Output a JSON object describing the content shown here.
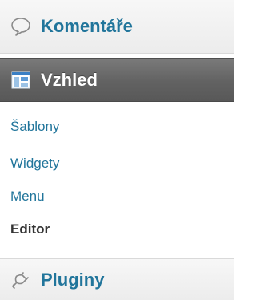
{
  "menu": {
    "comments": {
      "label": "Komentáře",
      "icon": "speech-bubble-icon"
    },
    "appearance": {
      "label": "Vzhled",
      "icon": "appearance-window-icon",
      "active": true
    },
    "appearance_submenu": [
      {
        "label": "Šablony"
      },
      {
        "label": "Widgety"
      },
      {
        "label": "Menu"
      },
      {
        "label": "Editor",
        "current": true
      }
    ],
    "plugins": {
      "label": "Pluginy",
      "icon": "plug-icon"
    }
  },
  "colors": {
    "link": "#21759b",
    "active_header_bg": "#636363",
    "current_text": "#333333"
  }
}
